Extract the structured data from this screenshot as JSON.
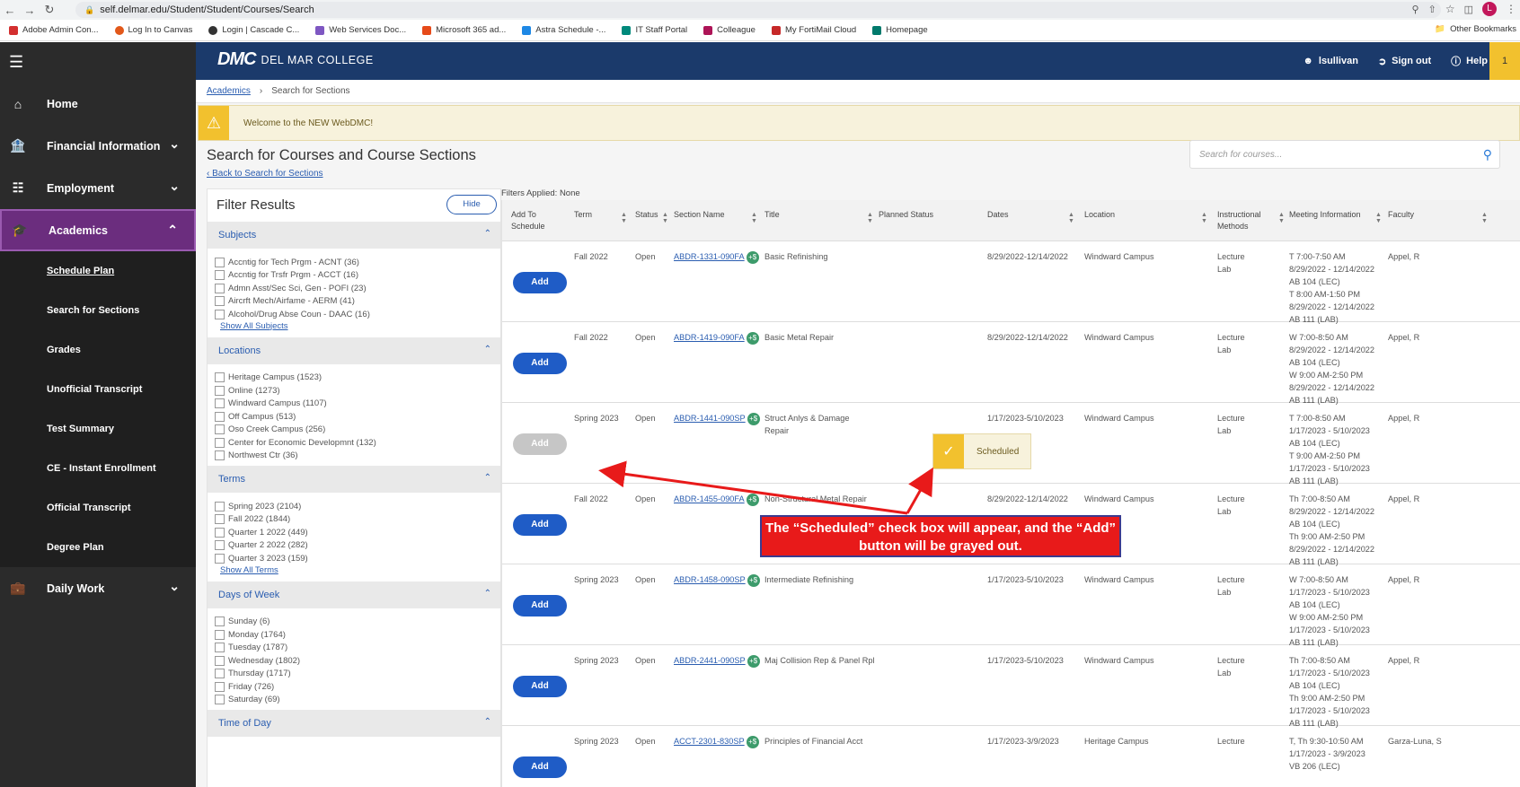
{
  "browser": {
    "url": "self.delmar.edu/Student/Student/Courses/Search",
    "profile_initial": "L",
    "bookmarks": [
      "Adobe Admin Con...",
      "Log In to Canvas",
      "Login | Cascade C...",
      "Web Services Doc...",
      "Microsoft 365 ad...",
      "Astra Schedule -...",
      "IT Staff Portal",
      "Colleague",
      "My FortiMail Cloud",
      "Homepage"
    ],
    "other_bookmarks": "Other Bookmarks"
  },
  "sidebar": {
    "items": [
      {
        "label": "Home",
        "icon": "home-icon"
      },
      {
        "label": "Financial Information",
        "icon": "bank-icon"
      },
      {
        "label": "Employment",
        "icon": "id-card-icon"
      },
      {
        "label": "Academics",
        "icon": "graduation-cap-icon"
      },
      {
        "label": "Daily Work",
        "icon": "briefcase-icon"
      }
    ],
    "academics_sub": [
      "Schedule Plan",
      "Search for Sections",
      "Grades",
      "Unofficial Transcript",
      "Test Summary",
      "CE - Instant Enrollment",
      "Official Transcript",
      "Degree Plan"
    ]
  },
  "header": {
    "logo_mark": "DMC",
    "logo_name": "DEL MAR COLLEGE",
    "user": "lsullivan",
    "sign_out": "Sign out",
    "help": "Help",
    "notification_count": "1"
  },
  "breadcrumb": {
    "root": "Academics",
    "current": "Search for Sections"
  },
  "alert": "Welcome to the NEW WebDMC!",
  "page": {
    "title": "Search for Courses and Course Sections",
    "back_link": "Back to Search for Sections",
    "search_placeholder": "Search for courses..."
  },
  "filter": {
    "title": "Filter Results",
    "hide": "Hide",
    "subjects_title": "Subjects",
    "subjects": [
      "Accntig for Tech Prgm - ACNT (36)",
      "Accntig for Trsfr Prgm - ACCT (16)",
      "Admn Asst/Sec Sci, Gen - POFI (23)",
      "Aircrft Mech/Airfame - AERM (41)",
      "Alcohol/Drug Abse Coun - DAAC (16)"
    ],
    "show_all_subjects": "Show All Subjects",
    "locations_title": "Locations",
    "locations": [
      "Heritage Campus (1523)",
      "Online (1273)",
      "Windward Campus (1107)",
      "Off Campus (513)",
      "Oso Creek Campus (256)",
      "Center for Economic Developmnt (132)",
      "Northwest Ctr (36)"
    ],
    "terms_title": "Terms",
    "terms": [
      "Spring 2023 (2104)",
      "Fall 2022 (1844)",
      "Quarter 1 2022 (449)",
      "Quarter 2 2022 (282)",
      "Quarter 3 2023 (159)"
    ],
    "show_all_terms": "Show All Terms",
    "days_title": "Days of Week",
    "days": [
      "Sunday (6)",
      "Monday (1764)",
      "Tuesday (1787)",
      "Wednesday (1802)",
      "Thursday (1717)",
      "Friday (726)",
      "Saturday (69)"
    ],
    "time_title": "Time of Day"
  },
  "filters_applied": "Filters Applied: None",
  "table": {
    "headers": {
      "add": "Add To Schedule",
      "term": "Term",
      "status": "Status",
      "section": "Section Name",
      "title": "Title",
      "planned": "Planned Status",
      "dates": "Dates",
      "location": "Location",
      "method": "Instructional Methods",
      "meeting": "Meeting Information",
      "faculty": "Faculty"
    },
    "add_label": "Add",
    "rows": [
      {
        "term": "Fall 2022",
        "status": "Open",
        "section": "ABDR-1331-090FA",
        "title": "Basic Refinishing",
        "dates": "8/29/2022-12/14/2022",
        "location": "Windward Campus",
        "method": "Lecture\nLab",
        "meeting": "T 7:00-7:50 AM\n8/29/2022 - 12/14/2022\nAB 104 (LEC)\nT 8:00 AM-1:50 PM\n8/29/2022 - 12/14/2022\nAB 111 (LAB)",
        "faculty": "Appel, R"
      },
      {
        "term": "Fall 2022",
        "status": "Open",
        "section": "ABDR-1419-090FA",
        "title": "Basic Metal Repair",
        "dates": "8/29/2022-12/14/2022",
        "location": "Windward Campus",
        "method": "Lecture\nLab",
        "meeting": "W 7:00-8:50 AM\n8/29/2022 - 12/14/2022\nAB 104 (LEC)\nW 9:00 AM-2:50 PM\n8/29/2022 - 12/14/2022\nAB 111 (LAB)",
        "faculty": "Appel, R"
      },
      {
        "term": "Spring 2023",
        "status": "Open",
        "section": "ABDR-1441-090SP",
        "title": "Struct Anlys & Damage Repair",
        "dates": "1/17/2023-5/10/2023",
        "location": "Windward Campus",
        "method": "Lecture\nLab",
        "meeting": "T 7:00-8:50 AM\n1/17/2023 - 5/10/2023\nAB 104 (LEC)\nT 9:00 AM-2:50 PM\n1/17/2023 - 5/10/2023\nAB 111 (LAB)",
        "faculty": "Appel, R"
      },
      {
        "term": "Fall 2022",
        "status": "Open",
        "section": "ABDR-1455-090FA",
        "title": "Non-Structural Metal Repair",
        "dates": "8/29/2022-12/14/2022",
        "location": "Windward Campus",
        "method": "Lecture\nLab",
        "meeting": "Th 7:00-8:50 AM\n8/29/2022 - 12/14/2022\nAB 104 (LEC)\nTh 9:00 AM-2:50 PM\n8/29/2022 - 12/14/2022\nAB 111 (LAB)",
        "faculty": "Appel, R"
      },
      {
        "term": "Spring 2023",
        "status": "Open",
        "section": "ABDR-1458-090SP",
        "title": "Intermediate Refinishing",
        "dates": "1/17/2023-5/10/2023",
        "location": "Windward Campus",
        "method": "Lecture\nLab",
        "meeting": "W 7:00-8:50 AM\n1/17/2023 - 5/10/2023\nAB 104 (LEC)\nW 9:00 AM-2:50 PM\n1/17/2023 - 5/10/2023\nAB 111 (LAB)",
        "faculty": "Appel, R"
      },
      {
        "term": "Spring 2023",
        "status": "Open",
        "section": "ABDR-2441-090SP",
        "title": "Maj Collision Rep & Panel Rpl",
        "dates": "1/17/2023-5/10/2023",
        "location": "Windward Campus",
        "method": "Lecture\nLab",
        "meeting": "Th 7:00-8:50 AM\n1/17/2023 - 5/10/2023\nAB 104 (LEC)\nTh 9:00 AM-2:50 PM\n1/17/2023 - 5/10/2023\nAB 111 (LAB)",
        "faculty": "Appel, R"
      },
      {
        "term": "Spring 2023",
        "status": "Open",
        "section": "ACCT-2301-830SP",
        "title": "Principles of Financial Acct",
        "dates": "1/17/2023-3/9/2023",
        "location": "Heritage Campus",
        "method": "Lecture",
        "meeting": "T, Th 9:30-10:50 AM\n1/17/2023 - 3/9/2023\nVB 206 (LEC)",
        "faculty": "Garza-Luna, S"
      }
    ]
  },
  "scheduled_badge": "Scheduled",
  "callout": "The “Scheduled” check box will appear, and the “Add” button will be grayed out.",
  "colors": {
    "navy": "#1b3a6b",
    "purple": "#6b2d7e",
    "gold": "#f2c12e",
    "blue": "#1f5cc6",
    "red": "#e81a1a"
  }
}
